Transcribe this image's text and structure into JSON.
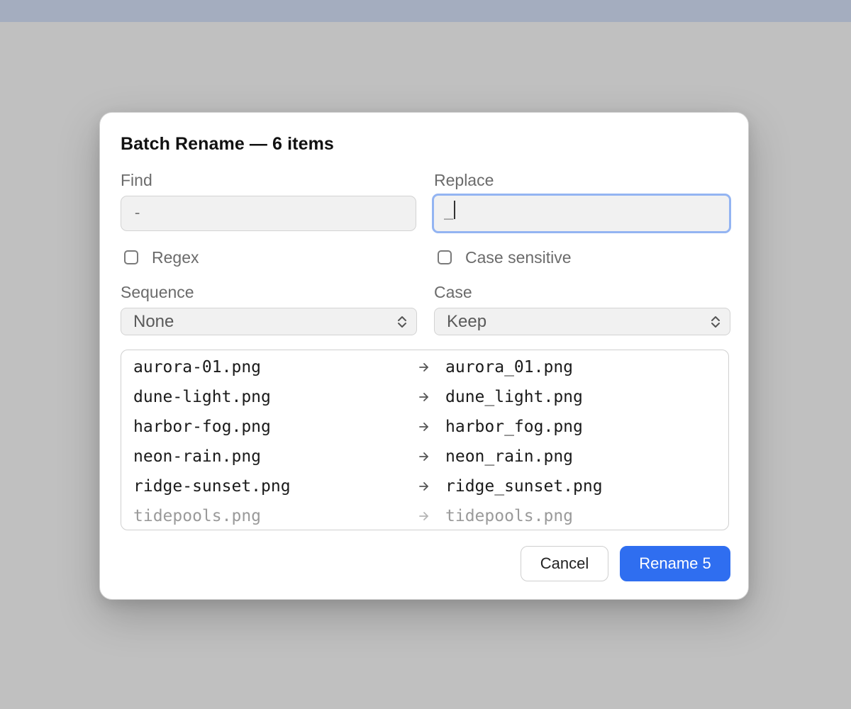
{
  "dialog": {
    "title": "Batch Rename — 6 items"
  },
  "find": {
    "label": "Find",
    "value": "-"
  },
  "replace": {
    "label": "Replace",
    "value": "_"
  },
  "options": {
    "regex_label": "Regex",
    "regex_checked": false,
    "case_sensitive_label": "Case sensitive",
    "case_sensitive_checked": false
  },
  "sequence": {
    "label": "Sequence",
    "value": "None"
  },
  "case": {
    "label": "Case",
    "value": "Keep"
  },
  "preview": {
    "rows": [
      {
        "old": "aurora-01.png",
        "new": "aurora_01.png",
        "changed": true
      },
      {
        "old": "dune-light.png",
        "new": "dune_light.png",
        "changed": true
      },
      {
        "old": "harbor-fog.png",
        "new": "harbor_fog.png",
        "changed": true
      },
      {
        "old": "neon-rain.png",
        "new": "neon_rain.png",
        "changed": true
      },
      {
        "old": "ridge-sunset.png",
        "new": "ridge_sunset.png",
        "changed": true
      },
      {
        "old": "tidepools.png",
        "new": "tidepools.png",
        "changed": false
      }
    ]
  },
  "buttons": {
    "cancel": "Cancel",
    "rename": "Rename 5"
  },
  "colors": {
    "accent": "#2f6ef0",
    "focus_ring": "#93b4f2",
    "dim_text": "#9a9a9a"
  },
  "icons": {
    "row_arrow": "arrow-right-icon",
    "select_chevron": "chevron-up-down-icon",
    "checkbox": "checkbox-icon"
  }
}
